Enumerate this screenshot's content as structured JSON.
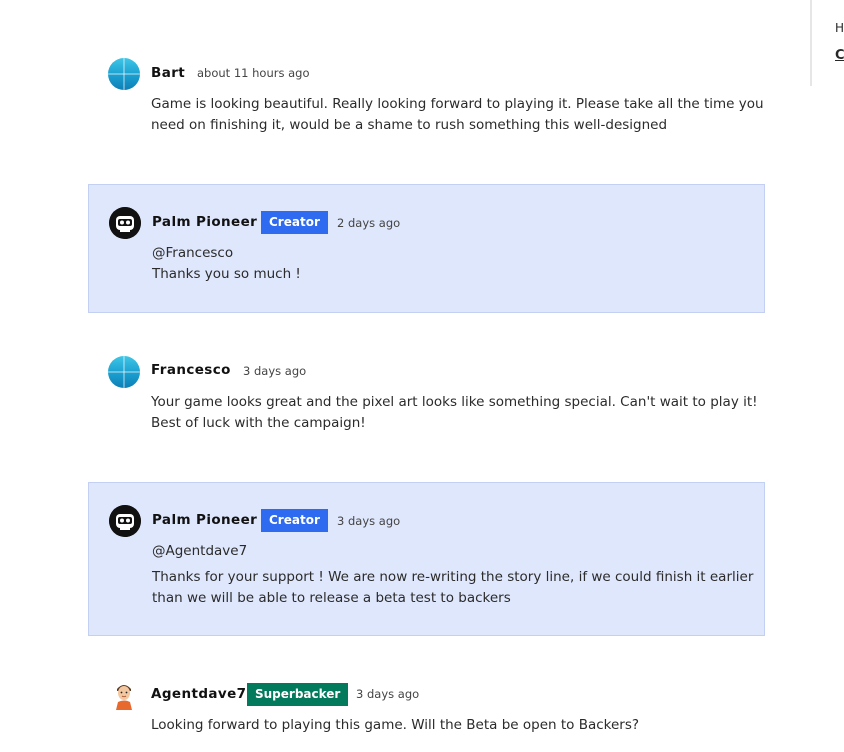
{
  "sidebar": {
    "text": "Ha",
    "link": "C"
  },
  "comments": [
    {
      "author": "Bart",
      "time": "about 11 hours ago",
      "lines": [
        "Game is looking beautiful. Really looking forward to playing it. Please take all the time you",
        "need on finishing it, would be a shame to rush something this well-designed"
      ]
    },
    {
      "author": "Palm Pioneer",
      "badge": "Creator",
      "time": "2 days ago",
      "lines": [
        "@Francesco",
        "Thanks you so much !"
      ]
    },
    {
      "author": "Francesco",
      "time": "3 days ago",
      "lines": [
        "Your game looks great and the pixel art looks like something special. Can't wait to play it!",
        "Best of luck with the campaign!"
      ]
    },
    {
      "author": "Palm Pioneer",
      "badge": "Creator",
      "time": "3 days ago",
      "mention": "@Agentdave7",
      "lines": [
        "Thanks for your support ! We are now re-writing the story line, if we could finish it earlier",
        "than we will be able to release a beta test to backers"
      ]
    },
    {
      "author": "Agentdave7",
      "badge": "Superbacker",
      "time": "3 days ago",
      "lines": [
        "Looking forward to playing this game. Will the Beta be open to Backers?"
      ]
    }
  ],
  "colors": {
    "creator_badge": "#2f6bf0",
    "superbacker_badge": "#027a5b",
    "creator_highlight": "#dfe7fc"
  }
}
